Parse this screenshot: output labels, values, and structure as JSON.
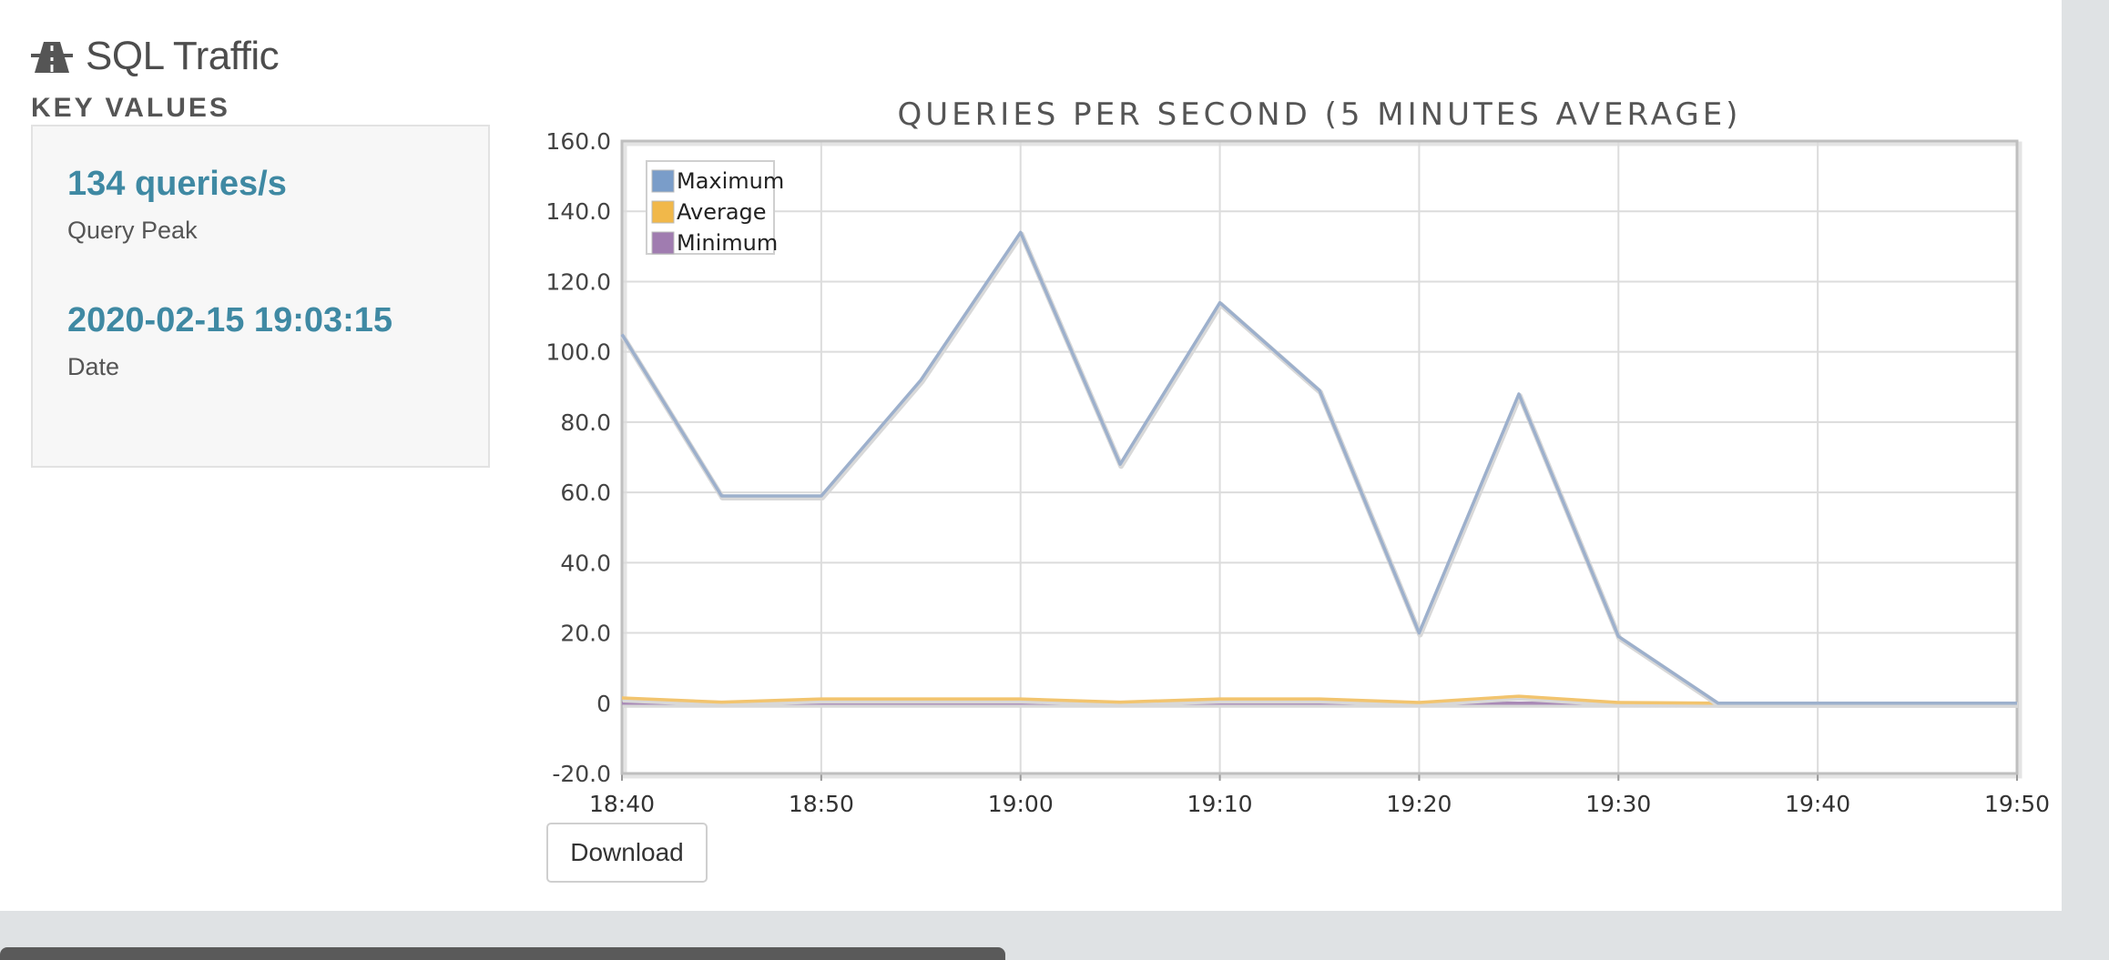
{
  "header": {
    "title": "SQL Traffic",
    "icon": "road-icon"
  },
  "key_values": {
    "section_label": "KEY VALUES",
    "items": [
      {
        "value": "134 queries/s",
        "label": "Query Peak"
      },
      {
        "value": "2020-02-15 19:03:15",
        "label": "Date"
      }
    ]
  },
  "download_label": "Download",
  "chart_data": {
    "type": "line",
    "title": "QUERIES PER SECOND (5 MINUTES AVERAGE)",
    "xlabel": "",
    "ylabel": "",
    "x": [
      "18:40",
      "18:45",
      "18:50",
      "18:55",
      "19:00",
      "19:05",
      "19:10",
      "19:15",
      "19:20",
      "19:25",
      "19:30",
      "19:35",
      "19:40",
      "19:45",
      "19:50"
    ],
    "x_ticks": [
      "18:40",
      "18:50",
      "19:00",
      "19:10",
      "19:20",
      "19:30",
      "19:40",
      "19:50"
    ],
    "y_ticks": [
      "160.0",
      "140.0",
      "120.0",
      "100.0",
      "80.0",
      "60.0",
      "40.0",
      "20.0",
      "0",
      "-20.0"
    ],
    "ylim": [
      -20,
      160
    ],
    "grid": true,
    "legend_position": "top-left",
    "series": [
      {
        "name": "Maximum",
        "color": "#9db0cc",
        "legend_color": "#7a9dc9",
        "values": [
          105,
          59,
          59,
          92,
          134,
          68,
          114,
          89,
          20,
          88,
          19,
          0,
          0,
          0,
          0
        ]
      },
      {
        "name": "Average",
        "color": "#f2c46e",
        "legend_color": "#f1b84a",
        "values": [
          1.5,
          0.3,
          1.2,
          1.2,
          1.2,
          0.3,
          1.2,
          1.2,
          0.2,
          2,
          0.2,
          0,
          0,
          0,
          0
        ]
      },
      {
        "name": "Minimum",
        "color": "#a98ab6",
        "legend_color": "#a07cb0",
        "values": [
          0,
          0,
          0,
          0,
          0,
          0,
          0,
          0,
          0,
          0,
          0,
          0,
          0,
          0,
          0
        ]
      }
    ]
  }
}
